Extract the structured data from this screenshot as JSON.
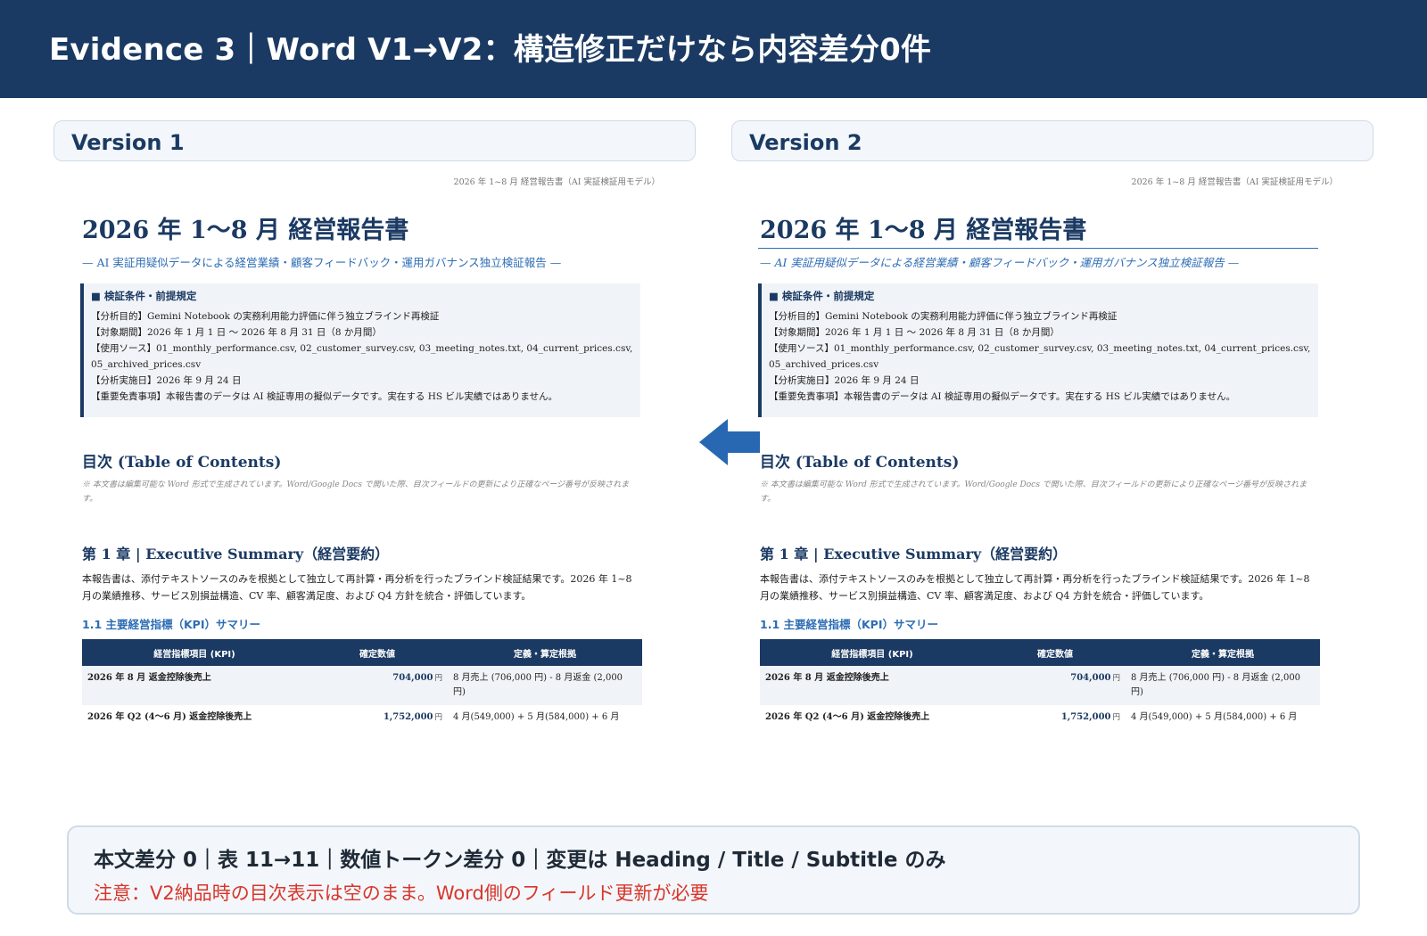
{
  "header": {
    "title": "Evidence 3｜Word V1→V2：構造修正だけなら内容差分0件"
  },
  "version1": {
    "label": "Version 1"
  },
  "version2": {
    "label": "Version 2"
  },
  "document": {
    "running_head": "2026 年 1~8 月 経営報告書（AI 実証検証用モデル）",
    "title": "2026 年 1〜8 月 経営報告書",
    "subtitle": "— AI 実証用疑似データによる経営業績・顧客フィードバック・運用ガバナンス独立検証報告 —",
    "conditions": {
      "heading": "■ 検証条件・前提規定",
      "lines": [
        "【分析目的】Gemini Notebook の実務利用能力評価に伴う独立ブラインド再検証",
        "【対象期間】2026 年 1 月 1 日 〜 2026 年 8 月 31 日（8 か月間）",
        "【使用ソース】01_monthly_performance.csv, 02_customer_survey.csv, 03_meeting_notes.txt, 04_current_prices.csv, 05_archived_prices.csv",
        "【分析実施日】2026 年 9 月 24 日",
        "【重要免責事項】本報告書のデータは AI 検証専用の擬似データです。実在する HS ビル実績ではありません。"
      ]
    },
    "toc": {
      "title": "目次 (Table of Contents)",
      "note": "※ 本文書は編集可能な Word 形式で生成されています。Word/Google Docs で開いた際、目次フィールドの更新により正確なページ番号が反映されます。"
    },
    "chapter1": {
      "title": "第 1 章 | Executive Summary（経営要約）",
      "body": "本報告書は、添付テキストソースのみを根拠として独立して再計算・再分析を行ったブラインド検証結果です。2026 年 1~8 月の業績推移、サービス別損益構造、CV 率、顧客満足度、および Q4 方針を統合・評価しています。"
    },
    "section_1_1": {
      "title": "1.1 主要経営指標（KPI）サマリー"
    },
    "kpi_table": {
      "headers": [
        "経営指標項目 (KPI)",
        "確定数値",
        "定義・算定根拠"
      ],
      "rows": [
        {
          "item": "2026 年 8 月 返金控除後売上",
          "value": "704,000",
          "unit": "円",
          "basis": "8 月売上 (706,000 円) - 8 月返金 (2,000 円)"
        },
        {
          "item": "2026 年 Q2 (4〜6 月) 返金控除後売上",
          "value": "1,752,000",
          "unit": "円",
          "basis": "4 月(549,000) + 5 月(584,000) + 6 月"
        }
      ]
    }
  },
  "summary": {
    "main": "本文差分 0｜表 11→11｜数値トークン差分 0｜変更は Heading / Title / Subtitle のみ",
    "note": "注意：V2納品時の目次表示は空のまま。Word側のフィールド更新が必要"
  },
  "colors": {
    "banner": "#1b3a63",
    "heading_blue": "#1b3a63",
    "accent_blue": "#2e6db4",
    "warning_red": "#d9352a",
    "panel_bg": "#f3f7fb"
  },
  "icons": {
    "arrow": "arrow-left-icon"
  }
}
